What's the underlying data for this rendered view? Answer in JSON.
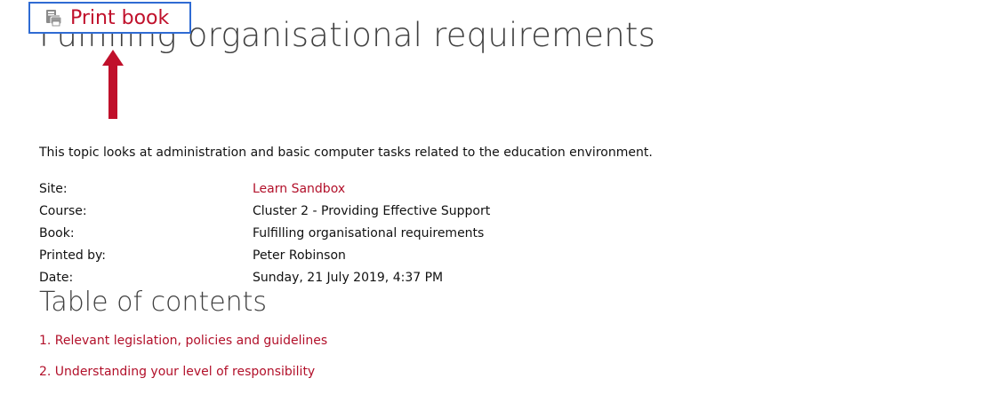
{
  "page": {
    "title": "Fulfilling organisational requirements"
  },
  "print_button": {
    "label": "Print book",
    "icon": "print-book-icon"
  },
  "annotation": {
    "icon": "red-arrow-up-icon",
    "color": "#c0102b"
  },
  "intro": "This topic looks at administration and basic computer tasks related to the education environment.",
  "meta": [
    {
      "key": "Site:",
      "value": "Learn Sandbox",
      "is_link": true
    },
    {
      "key": "Course:",
      "value": "Cluster 2 - Providing Effective Support",
      "is_link": false
    },
    {
      "key": "Book:",
      "value": "Fulfilling organisational requirements",
      "is_link": false
    },
    {
      "key": "Printed by:",
      "value": "Peter Robinson",
      "is_link": false
    },
    {
      "key": "Date:",
      "value": "Sunday, 21 July 2019, 4:37 PM",
      "is_link": false
    }
  ],
  "toc": {
    "title": "Table of contents",
    "items": [
      {
        "label": "1. Relevant legislation, policies and guidelines"
      },
      {
        "label": "2. Understanding your level of responsibility"
      }
    ]
  },
  "colors": {
    "link": "#b2102a",
    "button_border": "#2f6bd3",
    "heading": "#404040"
  }
}
